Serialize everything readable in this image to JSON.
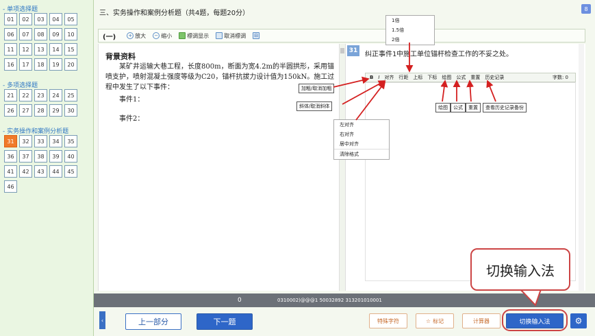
{
  "sidebar": {
    "sections": [
      {
        "title": "单项选择题",
        "items": [
          "01",
          "02",
          "03",
          "04",
          "05",
          "06",
          "07",
          "08",
          "09",
          "10",
          "11",
          "12",
          "13",
          "14",
          "15",
          "16",
          "17",
          "18",
          "19",
          "20"
        ]
      },
      {
        "title": "多项选择题",
        "items": [
          "21",
          "22",
          "23",
          "24",
          "25",
          "26",
          "27",
          "28",
          "29",
          "30"
        ]
      },
      {
        "title": "实务操作和案例分析题",
        "items": [
          "31",
          "32",
          "33",
          "34",
          "35",
          "36",
          "37",
          "38",
          "39",
          "40",
          "41",
          "42",
          "43",
          "44",
          "45",
          "46"
        ],
        "active": "31"
      }
    ]
  },
  "header": {
    "section_title": "三、实务操作和案例分析题（共4题，每题20分）",
    "corner_icon": "8"
  },
  "toolbar": {
    "part": "(一)",
    "zoom_in": "放大",
    "zoom_out": "缩小",
    "highlight": "標调显示",
    "unhighlight": "取消標调"
  },
  "material": {
    "title": "背景资料",
    "text": "某矿井运输大巷工程，长度800m，断面为宽4.2m的半圆拱形，采用锚喷支护，喷射混凝土强度等级为C20，锚杆抗拔力设计值为150kN。施工过程中发生了以下事件：",
    "event1": "事件1：",
    "event2": "事件2："
  },
  "question": {
    "number": "31",
    "text": "纠正事件1中施工单位锚杆检查工作的不妥之处。"
  },
  "editor": {
    "bold": "B",
    "italic": "I",
    "align": "对齐",
    "line_height": "行距",
    "superscript": "上标",
    "subscript": "下标",
    "draw": "绘图",
    "formula": "公式",
    "reset": "重置",
    "history": "历史记录",
    "word_count": "字数: 0"
  },
  "callouts": {
    "bold": "加粗/取消加粗",
    "italic": "斜体/取消斜体",
    "draw": "绘图",
    "formula": "公式",
    "reset": "重置",
    "history": "查看历史记录备份"
  },
  "line_height_menu": [
    "1倍",
    "1.5倍",
    "2倍"
  ],
  "align_menu": [
    "左对齐",
    "右对齐",
    "居中对齐",
    "清除格式"
  ],
  "status": {
    "left": "0",
    "code": "0310002)@@@1 50032892 313201010001"
  },
  "bottom": {
    "prev": "上一部分",
    "next": "下一题",
    "special": "特殊字符",
    "mark": "标记",
    "calc": "计算器",
    "switch": "切换输入法"
  },
  "big_callout": "切换输入法"
}
